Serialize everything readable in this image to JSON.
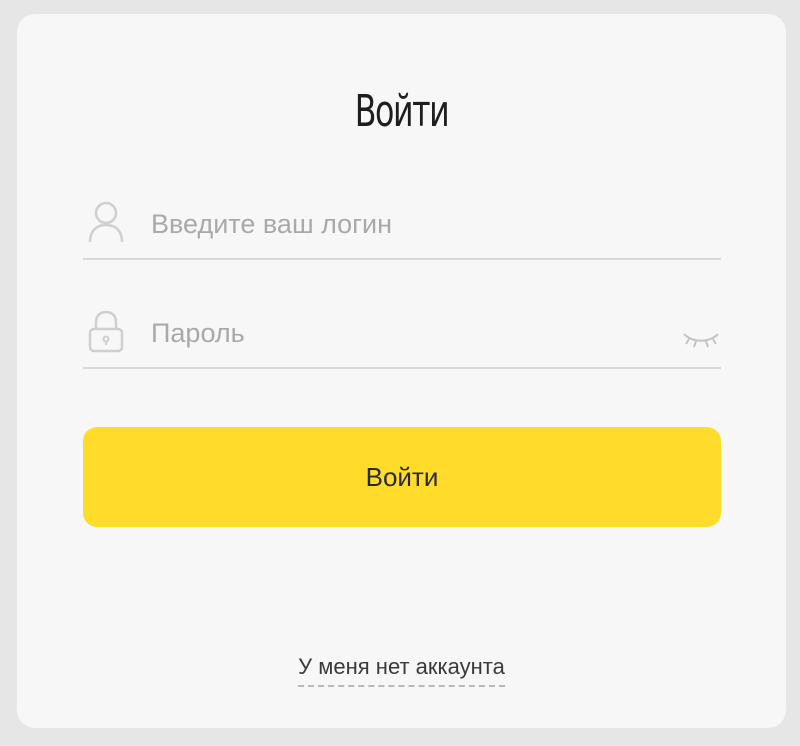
{
  "form": {
    "title": "Войти",
    "login": {
      "placeholder": "Введите ваш логин",
      "value": "",
      "icon": "user-icon"
    },
    "password": {
      "placeholder": "Пароль",
      "value": "",
      "icon": "lock-icon",
      "toggle_icon": "eye-closed-icon"
    },
    "submit_label": "Войти",
    "no_account_link": "У меня нет аккаунта"
  },
  "colors": {
    "page_background": "#e6e6e6",
    "card_background": "#f7f7f7",
    "accent": "#ffdb2a",
    "divider": "#d8d8d8",
    "placeholder": "#a9a9a9"
  }
}
